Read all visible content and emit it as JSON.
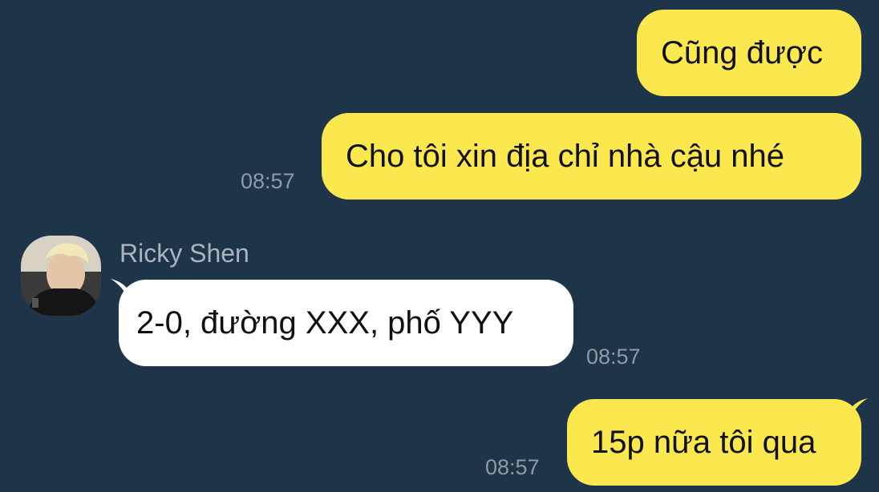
{
  "colors": {
    "background": "#1e3448",
    "outgoing_bubble": "#fbe84e",
    "incoming_bubble": "#ffffff",
    "timestamp": "#8e9aa6",
    "sender_name": "#a9b4bf"
  },
  "messages": [
    {
      "direction": "outgoing",
      "text": "Cũng được",
      "time": ""
    },
    {
      "direction": "outgoing",
      "text": "Cho tôi xin địa chỉ nhà cậu nhé",
      "time": "08:57"
    },
    {
      "direction": "incoming",
      "sender": "Ricky Shen",
      "text": "2-0, đường XXX, phố YYY",
      "time": "08:57"
    },
    {
      "direction": "outgoing",
      "text": "15p nữa tôi qua",
      "time": "08:57"
    }
  ],
  "icons": {
    "sender_avatar": "user-avatar-photo"
  }
}
